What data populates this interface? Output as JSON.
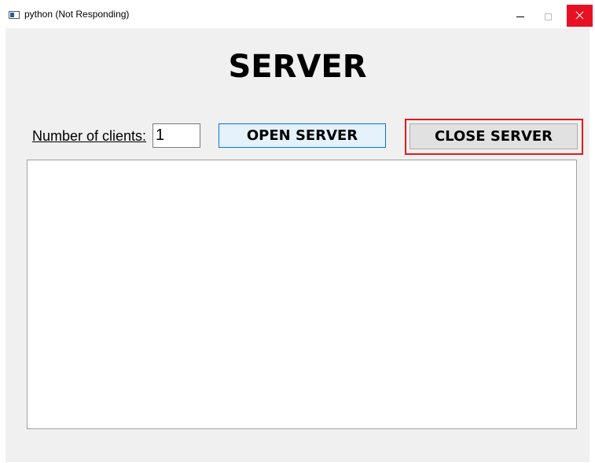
{
  "window": {
    "title": "python (Not Responding)",
    "controls": [
      "minimize",
      "maximize",
      "close"
    ]
  },
  "main": {
    "heading": "SERVER",
    "clients_label": "Number of clients:",
    "clients_value": "1",
    "open_button": "OPEN SERVER",
    "close_button": "CLOSE SERVER",
    "log_text": ""
  },
  "colors": {
    "close_window_button": "#e81123",
    "highlight_border": "#e01a1a",
    "open_button_bg": "#e5f1fb",
    "open_button_border": "#0078d7"
  }
}
